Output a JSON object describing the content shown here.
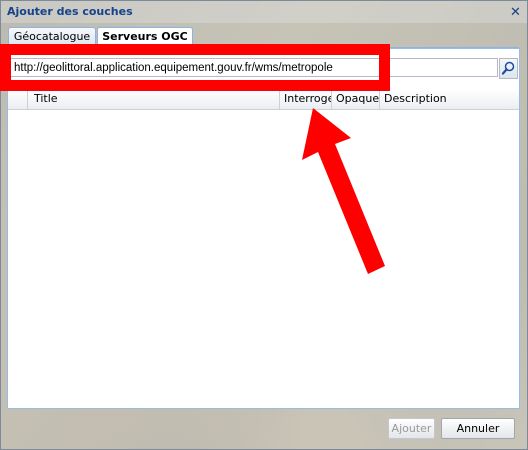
{
  "window": {
    "title": "Ajouter des couches"
  },
  "tabs": [
    {
      "label": "Géocatalogue",
      "active": false
    },
    {
      "label": "Serveurs OGC",
      "active": true
    }
  ],
  "server_url": {
    "value": "http://geolittoral.application.equipement.gouv.fr/wms/metropole"
  },
  "grid": {
    "columns": [
      "Title",
      "Interroge",
      "Opaque",
      "Description"
    ],
    "rows": []
  },
  "buttons": {
    "add": "Ajouter",
    "cancel": "Annuler"
  },
  "annotation": {
    "color": "#ff0000"
  },
  "icons": {
    "search": "magnifier-icon",
    "close": "close-icon"
  }
}
